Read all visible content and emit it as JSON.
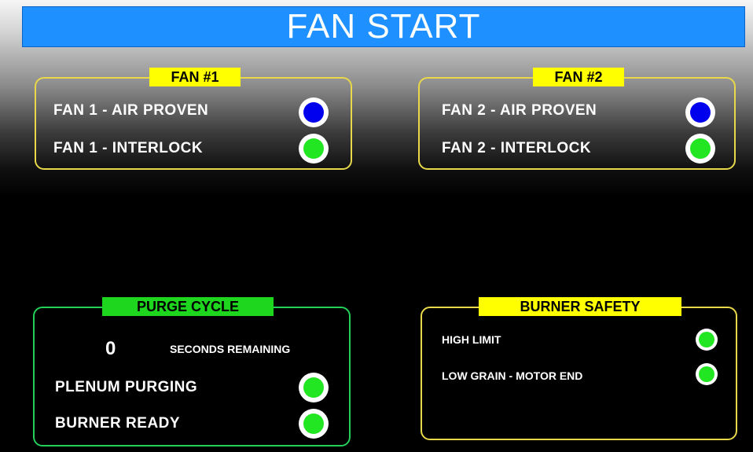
{
  "header": {
    "title": "FAN START"
  },
  "colors": {
    "title_bar": "#1e90ff",
    "label_yellow": "#ffff00",
    "label_green": "#1ed61e",
    "lamp_blue": "#0000ee",
    "lamp_green": "#22e622"
  },
  "fan1": {
    "label": "FAN #1",
    "rows": [
      {
        "label": "FAN 1 - AIR PROVEN",
        "indicator_color": "blue",
        "indicator": "status-light-icon"
      },
      {
        "label": "FAN 1 - INTERLOCK",
        "indicator_color": "green",
        "indicator": "status-light-icon"
      }
    ]
  },
  "fan2": {
    "label": "FAN #2",
    "rows": [
      {
        "label": "FAN 2 - AIR PROVEN",
        "indicator_color": "blue",
        "indicator": "status-light-icon"
      },
      {
        "label": "FAN 2 - INTERLOCK",
        "indicator_color": "green",
        "indicator": "status-light-icon"
      }
    ]
  },
  "purge": {
    "label": "PURGE CYCLE",
    "seconds_value": "0",
    "seconds_caption": "SECONDS REMAINING",
    "rows": [
      {
        "label": "PLENUM PURGING",
        "indicator_color": "green",
        "indicator": "status-light-icon"
      },
      {
        "label": "BURNER READY",
        "indicator_color": "green",
        "indicator": "status-light-icon"
      }
    ]
  },
  "burner_safety": {
    "label": "BURNER SAFETY",
    "rows": [
      {
        "label": "HIGH LIMIT",
        "indicator_color": "green",
        "indicator": "status-light-icon"
      },
      {
        "label": "LOW GRAIN - MOTOR END",
        "indicator_color": "green",
        "indicator": "status-light-icon"
      }
    ]
  }
}
